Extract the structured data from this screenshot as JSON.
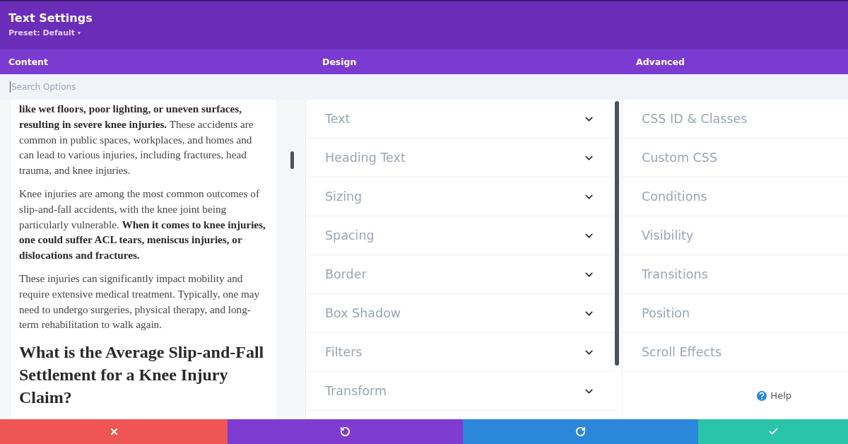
{
  "header": {
    "title": "Text Settings",
    "preset": "Preset: Default",
    "preset_caret": "▾"
  },
  "tabs": [
    {
      "label": "Content"
    },
    {
      "label": "Design"
    },
    {
      "label": "Advanced"
    }
  ],
  "search": {
    "placeholder": "Search Options"
  },
  "content": {
    "paragraphs": [
      "**like wet floors, poor lighting, or uneven surfaces, resulting in severe knee injuries.** These accidents are common in public spaces, workplaces, and homes and can lead to various injuries, including fractures, head trauma, and knee injuries.",
      "Knee injuries are among the most common outcomes of slip-and-fall accidents, with the knee joint being particularly vulnerable. **When it comes to knee injuries, one could suffer ACL tears, meniscus injuries, or dislocations and fractures.**",
      "These injuries can significantly impact mobility and require extensive medical treatment. Typically, one may need to undergo surgeries, physical therapy, and long-term rehabilitation to walk again."
    ],
    "heading": "What is the Average Slip-and-Fall Settlement for a Knee Injury Claim?"
  },
  "design_groups": [
    {
      "label": "Text",
      "expanded": false
    },
    {
      "label": "Heading Text",
      "expanded": false
    },
    {
      "label": "Sizing",
      "expanded": false
    },
    {
      "label": "Spacing",
      "expanded": false
    },
    {
      "label": "Border",
      "expanded": false
    },
    {
      "label": "Box Shadow",
      "expanded": false
    },
    {
      "label": "Filters",
      "expanded": false
    },
    {
      "label": "Transform",
      "expanded": false
    }
  ],
  "advanced_groups": [
    {
      "label": "CSS ID & Classes"
    },
    {
      "label": "Custom CSS"
    },
    {
      "label": "Conditions"
    },
    {
      "label": "Visibility"
    },
    {
      "label": "Transitions"
    },
    {
      "label": "Position"
    },
    {
      "label": "Scroll Effects"
    }
  ],
  "help": {
    "label": "Help"
  },
  "footer_buttons": [
    {
      "kind": "discard"
    },
    {
      "kind": "undo"
    },
    {
      "kind": "redo"
    },
    {
      "kind": "save"
    }
  ]
}
